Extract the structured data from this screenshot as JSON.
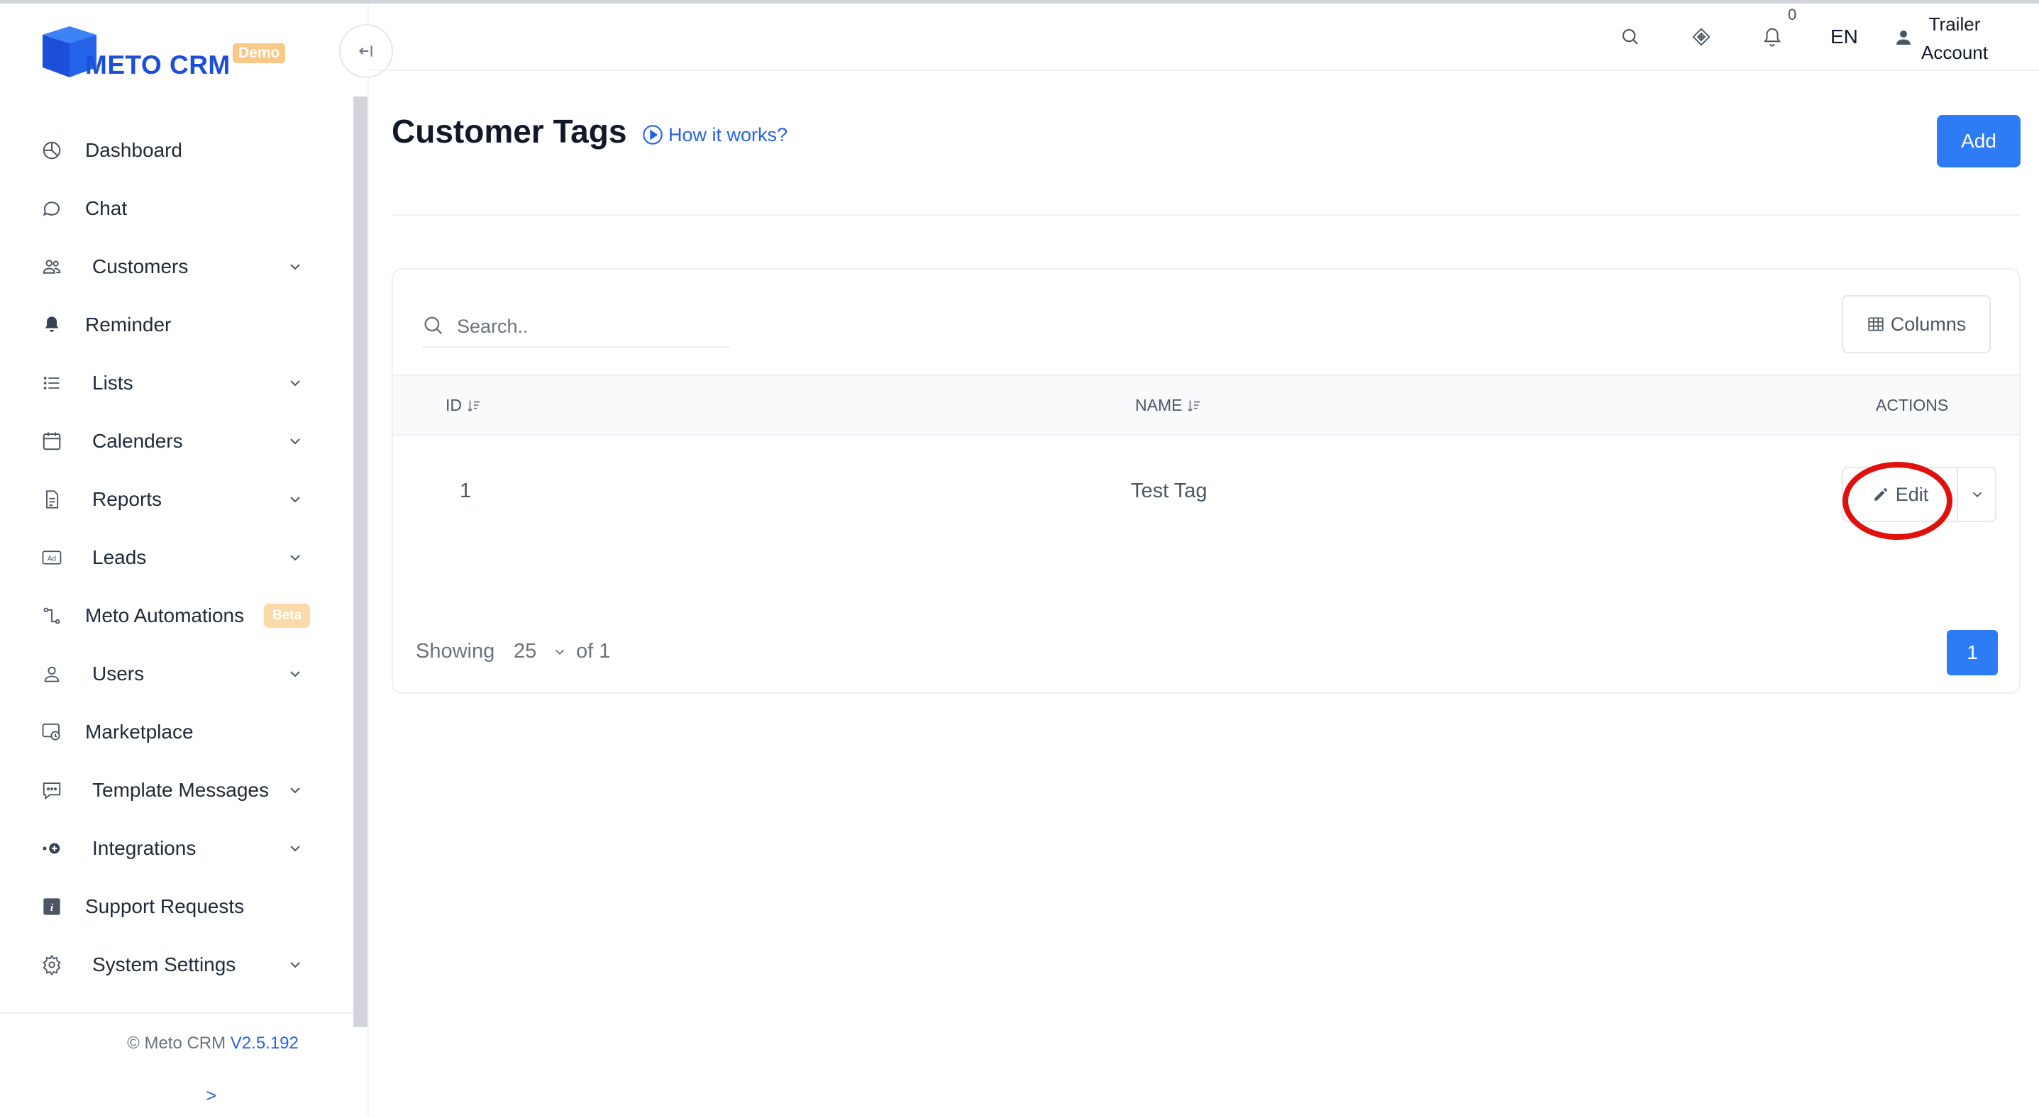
{
  "app": {
    "logo_text": "METO CRM",
    "logo_badge": "Demo",
    "brand_color": "#1d4ed8",
    "accent_color": "#2d7cf6"
  },
  "sidebar": {
    "items": [
      {
        "label": "Dashboard",
        "icon": "dashboard-icon",
        "has_chevron": false
      },
      {
        "label": "Chat",
        "icon": "chat-icon",
        "has_chevron": false
      },
      {
        "label": "Customers",
        "icon": "customers-icon",
        "has_chevron": true
      },
      {
        "label": "Reminder",
        "icon": "bell-icon",
        "has_chevron": false
      },
      {
        "label": "Lists",
        "icon": "list-icon",
        "has_chevron": true
      },
      {
        "label": "Calenders",
        "icon": "calendar-icon",
        "has_chevron": true
      },
      {
        "label": "Reports",
        "icon": "report-icon",
        "has_chevron": true
      },
      {
        "label": "Leads",
        "icon": "ad-icon",
        "has_chevron": true
      },
      {
        "label": "Meto Automations",
        "icon": "automation-icon",
        "has_chevron": false,
        "badge": "Beta"
      },
      {
        "label": "Users",
        "icon": "user-icon",
        "has_chevron": true
      },
      {
        "label": "Marketplace",
        "icon": "marketplace-icon",
        "has_chevron": false
      },
      {
        "label": "Template Messages",
        "icon": "message-template-icon",
        "has_chevron": true
      },
      {
        "label": "Integrations",
        "icon": "integration-icon",
        "has_chevron": true
      },
      {
        "label": "Support Requests",
        "icon": "info-icon",
        "has_chevron": false
      },
      {
        "label": "System Settings",
        "icon": "gear-icon",
        "has_chevron": true
      }
    ],
    "copyright_prefix": "© Meto CRM",
    "version": "V2.5.192",
    "expand_label": ">"
  },
  "header": {
    "notification_count": "0",
    "language": "EN",
    "user_line1": "Trailer",
    "user_line2": "Account"
  },
  "main": {
    "title": "Customer Tags",
    "how_it_works": "How it works?",
    "add_label": "Add",
    "search": {
      "placeholder": "Search..",
      "value": ""
    },
    "columns_label": "Columns",
    "table": {
      "headers": [
        "ID",
        "NAME",
        "ACTIONS"
      ],
      "rows": [
        {
          "id": "1",
          "name": "Test Tag",
          "action": "Edit"
        }
      ]
    },
    "pagination": {
      "showing_label": "Showing",
      "page_size": "25",
      "of_label": "of 1",
      "current_page": "1"
    }
  }
}
